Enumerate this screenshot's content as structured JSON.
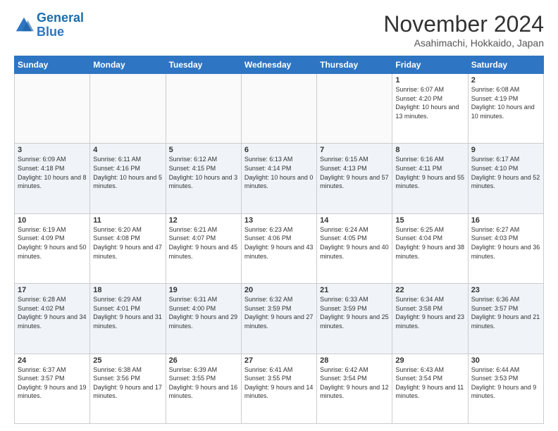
{
  "logo": {
    "line1": "General",
    "line2": "Blue"
  },
  "title": "November 2024",
  "location": "Asahimachi, Hokkaido, Japan",
  "weekdays": [
    "Sunday",
    "Monday",
    "Tuesday",
    "Wednesday",
    "Thursday",
    "Friday",
    "Saturday"
  ],
  "weeks": [
    [
      {
        "day": "",
        "info": ""
      },
      {
        "day": "",
        "info": ""
      },
      {
        "day": "",
        "info": ""
      },
      {
        "day": "",
        "info": ""
      },
      {
        "day": "",
        "info": ""
      },
      {
        "day": "1",
        "info": "Sunrise: 6:07 AM\nSunset: 4:20 PM\nDaylight: 10 hours and 13 minutes."
      },
      {
        "day": "2",
        "info": "Sunrise: 6:08 AM\nSunset: 4:19 PM\nDaylight: 10 hours and 10 minutes."
      }
    ],
    [
      {
        "day": "3",
        "info": "Sunrise: 6:09 AM\nSunset: 4:18 PM\nDaylight: 10 hours and 8 minutes."
      },
      {
        "day": "4",
        "info": "Sunrise: 6:11 AM\nSunset: 4:16 PM\nDaylight: 10 hours and 5 minutes."
      },
      {
        "day": "5",
        "info": "Sunrise: 6:12 AM\nSunset: 4:15 PM\nDaylight: 10 hours and 3 minutes."
      },
      {
        "day": "6",
        "info": "Sunrise: 6:13 AM\nSunset: 4:14 PM\nDaylight: 10 hours and 0 minutes."
      },
      {
        "day": "7",
        "info": "Sunrise: 6:15 AM\nSunset: 4:13 PM\nDaylight: 9 hours and 57 minutes."
      },
      {
        "day": "8",
        "info": "Sunrise: 6:16 AM\nSunset: 4:11 PM\nDaylight: 9 hours and 55 minutes."
      },
      {
        "day": "9",
        "info": "Sunrise: 6:17 AM\nSunset: 4:10 PM\nDaylight: 9 hours and 52 minutes."
      }
    ],
    [
      {
        "day": "10",
        "info": "Sunrise: 6:19 AM\nSunset: 4:09 PM\nDaylight: 9 hours and 50 minutes."
      },
      {
        "day": "11",
        "info": "Sunrise: 6:20 AM\nSunset: 4:08 PM\nDaylight: 9 hours and 47 minutes."
      },
      {
        "day": "12",
        "info": "Sunrise: 6:21 AM\nSunset: 4:07 PM\nDaylight: 9 hours and 45 minutes."
      },
      {
        "day": "13",
        "info": "Sunrise: 6:23 AM\nSunset: 4:06 PM\nDaylight: 9 hours and 43 minutes."
      },
      {
        "day": "14",
        "info": "Sunrise: 6:24 AM\nSunset: 4:05 PM\nDaylight: 9 hours and 40 minutes."
      },
      {
        "day": "15",
        "info": "Sunrise: 6:25 AM\nSunset: 4:04 PM\nDaylight: 9 hours and 38 minutes."
      },
      {
        "day": "16",
        "info": "Sunrise: 6:27 AM\nSunset: 4:03 PM\nDaylight: 9 hours and 36 minutes."
      }
    ],
    [
      {
        "day": "17",
        "info": "Sunrise: 6:28 AM\nSunset: 4:02 PM\nDaylight: 9 hours and 34 minutes."
      },
      {
        "day": "18",
        "info": "Sunrise: 6:29 AM\nSunset: 4:01 PM\nDaylight: 9 hours and 31 minutes."
      },
      {
        "day": "19",
        "info": "Sunrise: 6:31 AM\nSunset: 4:00 PM\nDaylight: 9 hours and 29 minutes."
      },
      {
        "day": "20",
        "info": "Sunrise: 6:32 AM\nSunset: 3:59 PM\nDaylight: 9 hours and 27 minutes."
      },
      {
        "day": "21",
        "info": "Sunrise: 6:33 AM\nSunset: 3:59 PM\nDaylight: 9 hours and 25 minutes."
      },
      {
        "day": "22",
        "info": "Sunrise: 6:34 AM\nSunset: 3:58 PM\nDaylight: 9 hours and 23 minutes."
      },
      {
        "day": "23",
        "info": "Sunrise: 6:36 AM\nSunset: 3:57 PM\nDaylight: 9 hours and 21 minutes."
      }
    ],
    [
      {
        "day": "24",
        "info": "Sunrise: 6:37 AM\nSunset: 3:57 PM\nDaylight: 9 hours and 19 minutes."
      },
      {
        "day": "25",
        "info": "Sunrise: 6:38 AM\nSunset: 3:56 PM\nDaylight: 9 hours and 17 minutes."
      },
      {
        "day": "26",
        "info": "Sunrise: 6:39 AM\nSunset: 3:55 PM\nDaylight: 9 hours and 16 minutes."
      },
      {
        "day": "27",
        "info": "Sunrise: 6:41 AM\nSunset: 3:55 PM\nDaylight: 9 hours and 14 minutes."
      },
      {
        "day": "28",
        "info": "Sunrise: 6:42 AM\nSunset: 3:54 PM\nDaylight: 9 hours and 12 minutes."
      },
      {
        "day": "29",
        "info": "Sunrise: 6:43 AM\nSunset: 3:54 PM\nDaylight: 9 hours and 11 minutes."
      },
      {
        "day": "30",
        "info": "Sunrise: 6:44 AM\nSunset: 3:53 PM\nDaylight: 9 hours and 9 minutes."
      }
    ]
  ]
}
